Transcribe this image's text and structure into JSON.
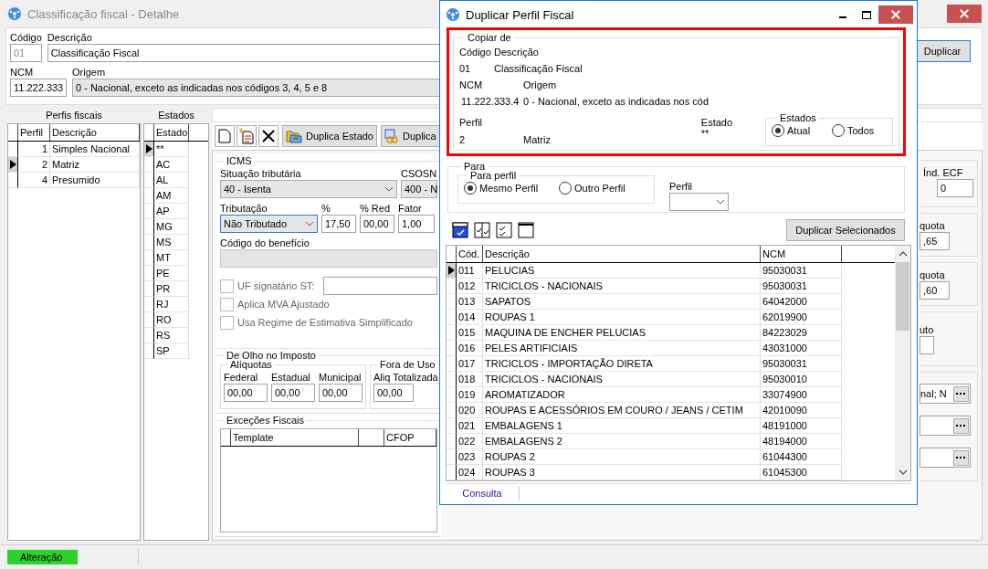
{
  "main_window": {
    "title": "Classificação fiscal - Detalhe"
  },
  "header": {
    "codigo_label": "Código",
    "codigo": "01",
    "descricao_label": "Descrição",
    "descricao": "Classificação Fiscal",
    "ncm_label": "NCM",
    "ncm": "11.222.333",
    "origem_label": "Origem",
    "origem": "0 - Nacional, exceto as indicadas nos códigos 3, 4, 5 e 8",
    "duplicar_button": "Duplicar"
  },
  "perfis": {
    "title": "Perfis fiscais",
    "columns": [
      "Perfil",
      "Descrição"
    ],
    "rows": [
      {
        "perfil": "1",
        "descricao": "Simples Nacional",
        "selected": false
      },
      {
        "perfil": "2",
        "descricao": "Matriz",
        "selected": true
      },
      {
        "perfil": "4",
        "descricao": "Presumido",
        "selected": false
      }
    ]
  },
  "estados": {
    "title": "Estados",
    "column": "Estado",
    "rows": [
      {
        "estado": "**",
        "selected": true
      },
      {
        "estado": "AC",
        "selected": false
      },
      {
        "estado": "AL",
        "selected": false
      },
      {
        "estado": "AM",
        "selected": false
      },
      {
        "estado": "AP",
        "selected": false
      },
      {
        "estado": "MG",
        "selected": false
      },
      {
        "estado": "MS",
        "selected": false
      },
      {
        "estado": "MT",
        "selected": false
      },
      {
        "estado": "PE",
        "selected": false
      },
      {
        "estado": "PR",
        "selected": false
      },
      {
        "estado": "RJ",
        "selected": false
      },
      {
        "estado": "RO",
        "selected": false
      },
      {
        "estado": "RS",
        "selected": false
      },
      {
        "estado": "SP",
        "selected": false
      }
    ]
  },
  "toolbar": {
    "duplica_estado": "Duplica Estado",
    "duplica_cut": "Duplica"
  },
  "icms": {
    "legend": "ICMS",
    "situacao_label": "Situação tributária",
    "situacao": "40 - Isenta",
    "csosn_label": "CSOSN",
    "csosn": "400 - N",
    "tributacao_label": "Tributação",
    "tributacao": "Não Tributado",
    "pct_label": "%",
    "pct": "17,50",
    "red_label": "% Red",
    "red": "00,00",
    "fator_label": "Fator",
    "fator": "1,00",
    "beneficio_label": "Código do benefício",
    "checks": [
      {
        "kind": "field",
        "label": "UF signatário ST:",
        "checked": false
      },
      {
        "kind": "plain",
        "label": "Aplica MVA Ajustado",
        "checked": false
      },
      {
        "kind": "plain",
        "label": "Usa Regime de Estimativa Simplificado",
        "checked": false
      }
    ]
  },
  "de_olho": {
    "legend": "De Olho no Imposto",
    "aliquotas": {
      "legend": "Alíquotas",
      "fields": [
        {
          "label": "Federal",
          "value": "00,00"
        },
        {
          "label": "Estadual",
          "value": "00,00"
        },
        {
          "label": "Municipal",
          "value": "00,00"
        }
      ]
    },
    "fora_de_uso": {
      "legend": "Fora de Uso",
      "label": "Aliq Totalizada",
      "value": "00,00"
    }
  },
  "excecoes": {
    "legend": "Exceções Fiscais",
    "template_column": "Template",
    "cfop_column": "CFOP"
  },
  "right_strip": {
    "ind_ecf_label": "Índ. ECF",
    "ind_ecf": "0",
    "boxes": [
      {
        "label": "quota",
        "value": ",65"
      },
      {
        "label": "quota",
        "value": ",60"
      }
    ],
    "uto_label": "uto",
    "lookup_value": "nal; N"
  },
  "status_bar": {
    "mode": "Alteração"
  },
  "dialog": {
    "title": "Duplicar Perfil Fiscal",
    "copiar_de": {
      "legend": "Copiar de",
      "codigo_label": "Código",
      "descricao_label": "Descrição",
      "codigo": "01",
      "descricao": "Classificação Fiscal",
      "ncm_label": "NCM",
      "origem_label": "Origem",
      "ncm": "11.222.333.4",
      "origem": "0 - Nacional, exceto as indicadas nos cód",
      "perfil_label": "Perfil",
      "perfil": "2",
      "perfil_nome": "Matriz",
      "estado_label": "Estado",
      "estado": "**",
      "estados": {
        "legend": "Estados",
        "options": [
          {
            "label": "Atual",
            "selected": true
          },
          {
            "label": "Todos",
            "selected": false
          }
        ]
      }
    },
    "para": {
      "legend": "Para",
      "para_perfil": {
        "legend": "Para perfil",
        "options": [
          {
            "label": "Mesmo Perfil",
            "selected": true
          },
          {
            "label": "Outro Perfil",
            "selected": false
          }
        ]
      },
      "perfil_label": "Perfil"
    },
    "duplicar_button": "Duplicar Selecionados",
    "table": {
      "columns": [
        "Cód.",
        "Descrição",
        "NCM"
      ],
      "rows": [
        {
          "cod": "011",
          "descricao": "PELUCIAS",
          "ncm": "95030031",
          "selected": true
        },
        {
          "cod": "012",
          "descricao": "TRICICLOS - NACIONAIS",
          "ncm": "95030031",
          "selected": false
        },
        {
          "cod": "013",
          "descricao": "SAPATOS",
          "ncm": "64042000",
          "selected": false
        },
        {
          "cod": "014",
          "descricao": "ROUPAS 1",
          "ncm": "62019900",
          "selected": false
        },
        {
          "cod": "015",
          "descricao": "MAQUINA DE ENCHER PELUCIAS",
          "ncm": "84223029",
          "selected": false
        },
        {
          "cod": "016",
          "descricao": "PELES ARTIFICIAIS",
          "ncm": "43031000",
          "selected": false
        },
        {
          "cod": "017",
          "descricao": "TRICICLOS - IMPORTAÇÃO DIRETA",
          "ncm": "95030031",
          "selected": false
        },
        {
          "cod": "018",
          "descricao": "TRICICLOS - NACIONAIS",
          "ncm": "95030010",
          "selected": false
        },
        {
          "cod": "019",
          "descricao": "AROMATIZADOR",
          "ncm": "33074900",
          "selected": false
        },
        {
          "cod": "020",
          "descricao": "ROUPAS E ACESSÓRIOS EM COURO / JEANS / CETIM",
          "ncm": "42010090",
          "selected": false
        },
        {
          "cod": "021",
          "descricao": "EMBALAGENS 1",
          "ncm": "48191000",
          "selected": false
        },
        {
          "cod": "022",
          "descricao": "EMBALAGENS 2",
          "ncm": "48194000",
          "selected": false
        },
        {
          "cod": "023",
          "descricao": "ROUPAS 2",
          "ncm": "61044300",
          "selected": false
        },
        {
          "cod": "024",
          "descricao": "ROUPAS 3",
          "ncm": "61045300",
          "selected": false
        }
      ]
    },
    "status": "Consulta"
  }
}
